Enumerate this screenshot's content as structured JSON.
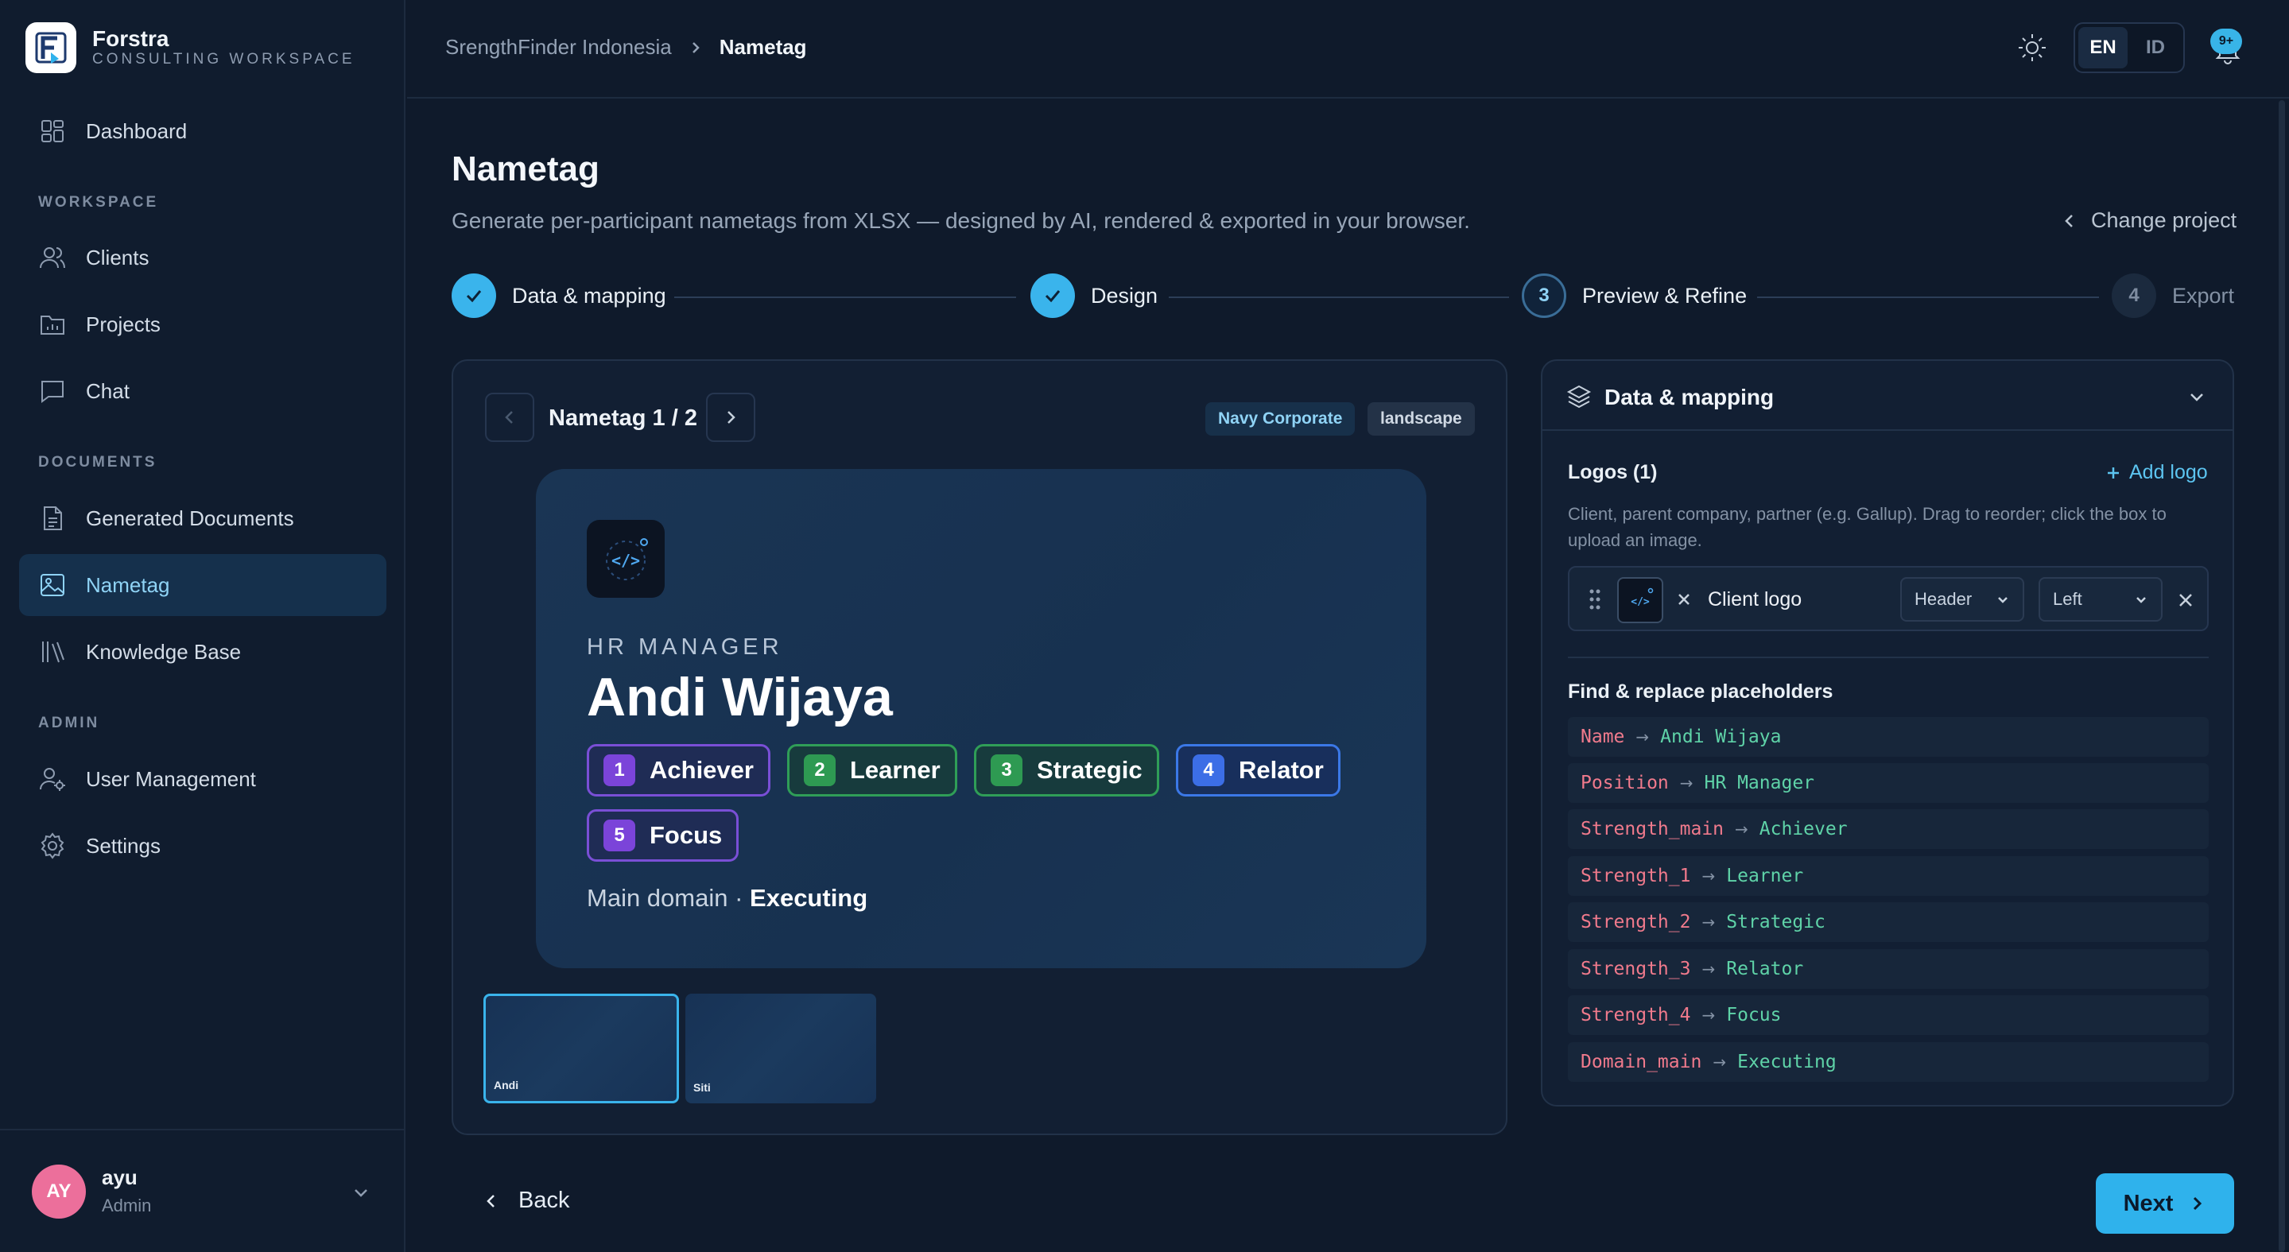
{
  "brand": {
    "name": "Forstra",
    "subtitle": "CONSULTING WORKSPACE"
  },
  "sidebar": {
    "dashboard": "Dashboard",
    "sections": {
      "workspace": "WORKSPACE",
      "documents": "DOCUMENTS",
      "admin": "ADMIN"
    },
    "items": [
      {
        "label": "Clients",
        "icon": "users-icon"
      },
      {
        "label": "Projects",
        "icon": "folder-chart-icon"
      },
      {
        "label": "Chat",
        "icon": "chat-icon"
      },
      {
        "label": "Generated Documents",
        "icon": "document-icon"
      },
      {
        "label": "Nametag",
        "icon": "image-icon",
        "active": true
      },
      {
        "label": "Knowledge Base",
        "icon": "library-icon"
      },
      {
        "label": "User Management",
        "icon": "user-cog-icon"
      },
      {
        "label": "Settings",
        "icon": "gear-icon"
      }
    ],
    "user": {
      "initials": "AY",
      "name": "ayu",
      "role": "Admin"
    }
  },
  "topbar": {
    "breadcrumb": [
      "SrengthFinder Indonesia",
      "Nametag"
    ],
    "lang": {
      "en": "EN",
      "id": "ID",
      "selected": "EN"
    },
    "notifications": "9+"
  },
  "page": {
    "title": "Nametag",
    "subtitle": "Generate per-participant nametags from XLSX — designed by AI, rendered & exported in your browser.",
    "change_project": "Change project"
  },
  "stepper": [
    {
      "num": "1",
      "label": "Data & mapping",
      "state": "done"
    },
    {
      "num": "2",
      "label": "Design",
      "state": "done"
    },
    {
      "num": "3",
      "label": "Preview & Refine",
      "state": "current"
    },
    {
      "num": "4",
      "label": "Export",
      "state": "todo"
    }
  ],
  "preview": {
    "pager": "Nametag 1 / 2",
    "tags": [
      "Navy Corporate",
      "landscape"
    ],
    "nametag": {
      "role": "HR MANAGER",
      "name": "Andi Wijaya",
      "strengths": [
        {
          "num": "1",
          "label": "Achiever",
          "color": "#7b44d9"
        },
        {
          "num": "2",
          "label": "Learner",
          "color": "#2e9a52"
        },
        {
          "num": "3",
          "label": "Strategic",
          "color": "#2e9a52"
        },
        {
          "num": "4",
          "label": "Relator",
          "color": "#3c6ee6"
        },
        {
          "num": "5",
          "label": "Focus",
          "color": "#7b44d9"
        }
      ],
      "domain_prefix": "Main domain · ",
      "domain": "Executing"
    },
    "thumbs": [
      "Andi",
      "Siti"
    ]
  },
  "mapping": {
    "title": "Data & mapping",
    "logos_title": "Logos (1)",
    "add_logo": "Add logo",
    "logos_help": "Client, parent company, partner (e.g. Gallup). Drag to reorder; click the box to upload an image.",
    "logo": {
      "name": "Client logo",
      "position": "Header",
      "align": "Left"
    },
    "find_replace_title": "Find & replace placeholders",
    "placeholders": [
      {
        "key": "Name",
        "value": "Andi Wijaya"
      },
      {
        "key": "Position",
        "value": "HR Manager"
      },
      {
        "key": "Strength_main",
        "value": "Achiever"
      },
      {
        "key": "Strength_1",
        "value": "Learner"
      },
      {
        "key": "Strength_2",
        "value": "Strategic"
      },
      {
        "key": "Strength_3",
        "value": "Relator"
      },
      {
        "key": "Strength_4",
        "value": "Focus"
      },
      {
        "key": "Domain_main",
        "value": "Executing"
      }
    ],
    "arrow": "→"
  },
  "footer": {
    "back": "Back",
    "next": "Next"
  },
  "colors": {
    "accent": "#2fb2ec",
    "background": "#0f1a2b",
    "placeholder_key": "#f07a8c",
    "placeholder_value": "#5fd3a8"
  }
}
